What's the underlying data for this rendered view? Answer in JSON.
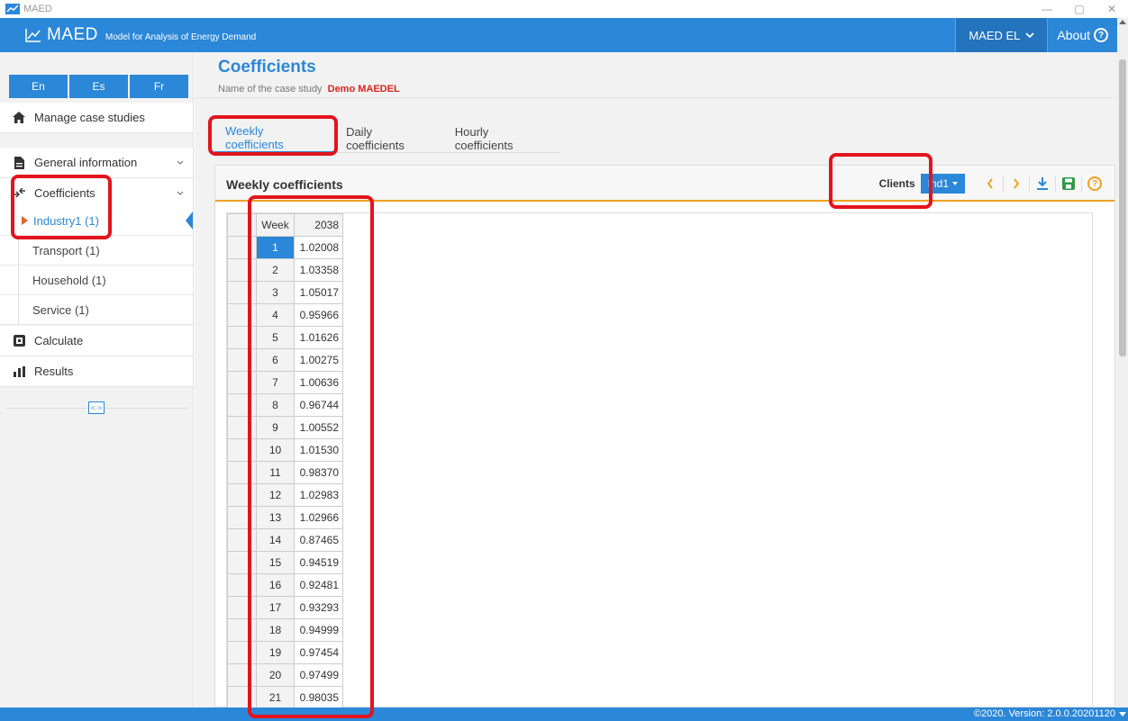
{
  "window": {
    "title": "MAED",
    "controls": [
      "—",
      "▢",
      "✕"
    ]
  },
  "appbar": {
    "brand_name": "MAED",
    "brand_sub": "Model for Analysis of Energy Demand",
    "model_menu": "MAED EL",
    "about": "About"
  },
  "sidebar": {
    "languages": [
      "En",
      "Es",
      "Fr"
    ],
    "manage": "Manage case studies",
    "general": "General information",
    "coefficients": "Coefficients",
    "sub_items": [
      "Industry1 (1)",
      "Transport (1)",
      "Household (1)",
      "Service (1)"
    ],
    "calculate": "Calculate",
    "results": "Results"
  },
  "page": {
    "title": "Coefficients",
    "case_label": "Name of the case study",
    "case_name": "Demo MAEDEL"
  },
  "tabs": [
    "Weekly coefficients",
    "Daily coefficients",
    "Hourly coefficients"
  ],
  "panel": {
    "title": "Weekly coefficients",
    "clients_label": "Clients",
    "client_value": "Ind1"
  },
  "grid": {
    "col_week": "Week",
    "col_year": "2038",
    "rows": [
      [
        "1",
        "1.02008"
      ],
      [
        "2",
        "1.03358"
      ],
      [
        "3",
        "1.05017"
      ],
      [
        "4",
        "0.95966"
      ],
      [
        "5",
        "1.01626"
      ],
      [
        "6",
        "1.00275"
      ],
      [
        "7",
        "1.00636"
      ],
      [
        "8",
        "0.96744"
      ],
      [
        "9",
        "1.00552"
      ],
      [
        "10",
        "1.01530"
      ],
      [
        "11",
        "0.98370"
      ],
      [
        "12",
        "1.02983"
      ],
      [
        "13",
        "1.02966"
      ],
      [
        "14",
        "0.87465"
      ],
      [
        "15",
        "0.94519"
      ],
      [
        "16",
        "0.92481"
      ],
      [
        "17",
        "0.93293"
      ],
      [
        "18",
        "0.94999"
      ],
      [
        "19",
        "0.97454"
      ],
      [
        "20",
        "0.97499"
      ],
      [
        "21",
        "0.98035"
      ]
    ]
  },
  "status": {
    "version": "©2020. Version: 2.0.0.20201120"
  },
  "colors": {
    "primary": "#2b87d8",
    "accent": "#f0a020",
    "annotation": "#e3141d"
  }
}
